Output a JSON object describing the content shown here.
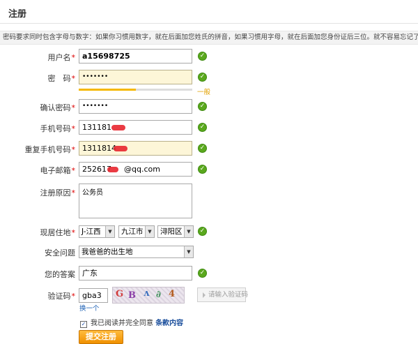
{
  "page": {
    "title": "注册",
    "hint": "密码要求同时包含字母与数字：如果你习惯用数字，就在后面加您姓氏的拼音，如果习惯用字母，就在后面加您身份证后三位。就不容易忘记了！"
  },
  "form": {
    "username": {
      "label": "用户名",
      "value": "a15698725"
    },
    "password": {
      "label": "密　码",
      "value": "•••••••"
    },
    "strength": {
      "label": "一般",
      "level": 0.5
    },
    "confirm_password": {
      "label": "确认密码",
      "value": "•••••••"
    },
    "phone": {
      "label": "手机号码",
      "value": "131181"
    },
    "phone_repeat": {
      "label": "重复手机号码",
      "value": "1311814"
    },
    "email": {
      "label": "电子邮箱",
      "value_prefix": "252617",
      "value_suffix": "@qq.com"
    },
    "reason": {
      "label": "注册原因",
      "value": "公务员"
    },
    "location": {
      "label": "现居住地",
      "province": "J-江西",
      "city": "九江市",
      "district": "浔阳区"
    },
    "security_question": {
      "label": "安全问题",
      "value": "我爸爸的出生地"
    },
    "answer": {
      "label": "您的答案",
      "value": "广东"
    },
    "captcha": {
      "label": "验证码",
      "value": "gba3",
      "change_label": "换一个",
      "input_button_label": "请输入验证码"
    },
    "agree": {
      "prefix": "我已阅读并完全同意",
      "link": "条款内容"
    },
    "submit_label": "提交注册",
    "required_mark": "*",
    "ok_mark": "✓"
  },
  "colors": {
    "ok": "#5aa81d",
    "required": "#dd0000",
    "highlight": "#fdf6d8",
    "strength": "#f5b800",
    "submit": "#f09000"
  }
}
